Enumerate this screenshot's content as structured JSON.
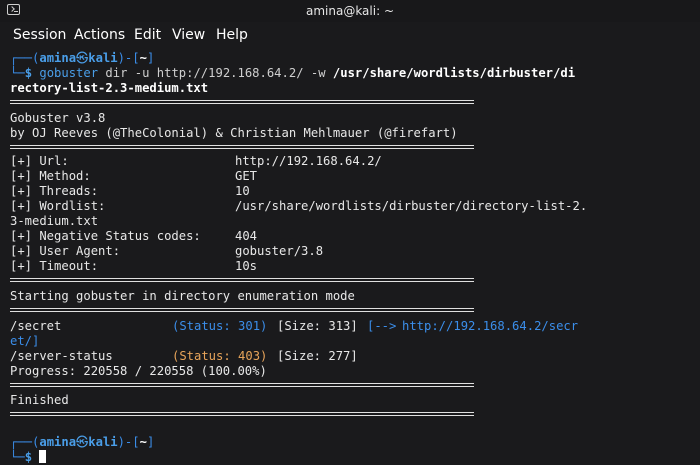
{
  "window": {
    "title": "amina@kali: ~"
  },
  "menu": {
    "items": [
      "Session",
      "Actions",
      "Edit",
      "View",
      "Help"
    ]
  },
  "prompt": {
    "open": "┌──(",
    "user": "amina",
    "skull": "㉿",
    "host": "kali",
    "mid": ")-[",
    "dir": "~",
    "close": "]",
    "corner": "└─",
    "dollar": "$"
  },
  "command": {
    "prog": "gobuster",
    "args": " dir -u http://192.168.64.2/ -w ",
    "path_line1": "/usr/share/wordlists/dirbuster/di",
    "path_line2": "rectory-list-2.3-medium.txt"
  },
  "banner": {
    "version": "Gobuster v3.8",
    "authors": "by OJ Reeves (@TheColonial) & Christian Mehlmauer (@firefart)"
  },
  "config": [
    {
      "key": "[+] Url:",
      "value": "http://192.168.64.2/"
    },
    {
      "key": "[+] Method:",
      "value": "GET"
    },
    {
      "key": "[+] Threads:",
      "value": "10"
    },
    {
      "key": "[+] Wordlist:",
      "value": "/usr/share/wordlists/dirbuster/directory-list-2."
    },
    {
      "key": "3-medium.txt",
      "value": ""
    },
    {
      "key": "[+] Negative Status codes:",
      "value": "404"
    },
    {
      "key": "[+] User Agent:",
      "value": "gobuster/3.8"
    },
    {
      "key": "[+] Timeout:",
      "value": "10s"
    }
  ],
  "start_msg": "Starting gobuster in directory enumeration mode",
  "results": {
    "r1": {
      "path": "/secret",
      "status": "(Status: 301)",
      "size": "[Size: 313]",
      "redirect": "[-->",
      "url1": "http://192.168.64.2/secr",
      "url2": "et/]"
    },
    "r2": {
      "path": "/server-status",
      "status": "(Status: 403)",
      "size": "[Size: 277]"
    }
  },
  "progress": "Progress: 220558 / 220558 (100.00%)",
  "finished": "Finished"
}
